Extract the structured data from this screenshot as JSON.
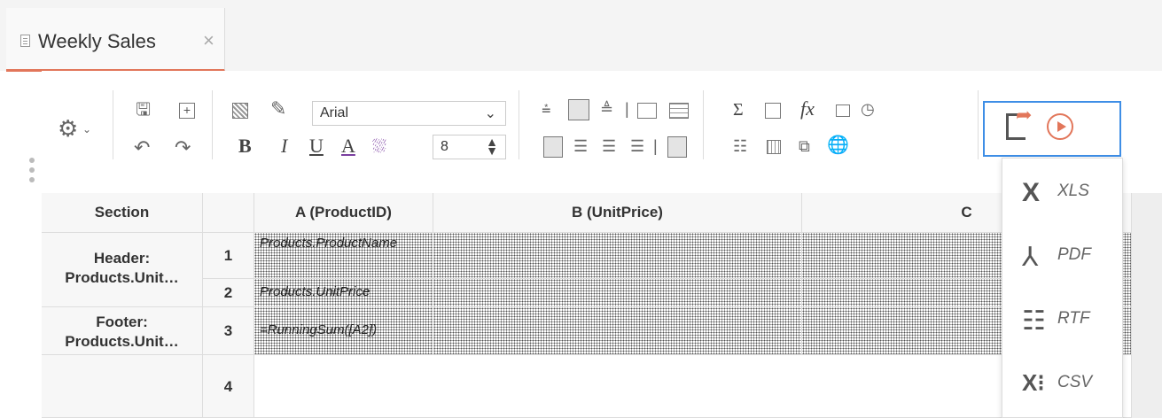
{
  "tab": {
    "title": "Weekly Sales",
    "close": "×"
  },
  "toolbar": {
    "font_family": "Arial",
    "font_size": "8",
    "bold": "B",
    "italic": "I",
    "underline": "U",
    "font_color": "A",
    "sum": "Σ",
    "fx": "fx"
  },
  "grid": {
    "headers": [
      "Section",
      "",
      "A (ProductID)",
      "B (UnitPrice)",
      "C"
    ],
    "rows": [
      {
        "num": "1",
        "a": "Products.ProductName"
      },
      {
        "num": "2",
        "a": "Products.UnitPrice"
      },
      {
        "num": "3",
        "a": "=RunningSum([A2])"
      },
      {
        "num": "4",
        "a": ""
      }
    ],
    "sections": [
      "Header: Products.Unit…",
      "Footer: Products.Unit…"
    ]
  },
  "export_menu": {
    "items": [
      {
        "icon": "X",
        "label": "XLS"
      },
      {
        "icon": "⅄",
        "label": "PDF"
      },
      {
        "icon": "☷",
        "label": "RTF"
      },
      {
        "icon": "X⁝",
        "label": "CSV"
      }
    ]
  }
}
